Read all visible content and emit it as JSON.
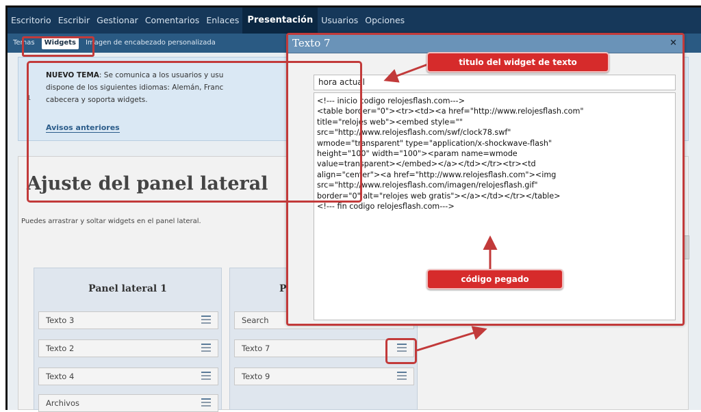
{
  "topnav": {
    "items": [
      "Escritorio",
      "Escribir",
      "Gestionar",
      "Comentarios",
      "Enlaces",
      "Presentación",
      "Usuarios",
      "Opciones"
    ],
    "active": "Presentación"
  },
  "subnav": {
    "items": [
      "Temas",
      "Widgets",
      "Imagen de encabezado personalizada"
    ],
    "active": "Widgets"
  },
  "notice": {
    "strong": "NUEVO TEMA",
    "text_line1": ": Se comunica a los usuarios y usu",
    "text_line2": "dispone de los siguientes idiomas: Alemán, Franc",
    "text_line3": "cabecera y soporta widgets.",
    "number": "1",
    "link": "Avisos anteriores"
  },
  "main": {
    "title": "Ajuste del panel lateral",
    "subtitle": "Puedes arrastrar y soltar widgets en el panel lateral."
  },
  "panel1": {
    "title": "Panel lateral 1",
    "widgets": [
      "Texto 3",
      "Texto 2",
      "Texto 4",
      "Archivos"
    ]
  },
  "panel2": {
    "title": "P",
    "widgets": [
      "Search",
      "Texto 7",
      "Texto 9"
    ]
  },
  "modal": {
    "title": "Texto 7",
    "close": "×",
    "title_value": "hora actual",
    "code": "<!--- inicio codigo relojesflash.com--->\n<table border=\"0\"><tr><td><a href=\"http://www.relojesflash.com\"\ntitle=\"relojes web\"><embed style=\"\"\nsrc=\"http://www.relojesflash.com/swf/clock78.swf\"\nwmode=\"transparent\" type=\"application/x-shockwave-flash\"\nheight=\"100\" width=\"100\"><param name=wmode\nvalue=transparent></embed></a></td></tr><tr><td\nalign=\"center\"><a href=\"http://www.relojesflash.com\"><img\nsrc=\"http://www.relojesflash.com/imagen/relojesflash.gif\"\nborder=\"0\" alt=\"relojes web gratis\"></a></td></tr></table>\n<!--- fin codigo relojesflash.com--->"
  },
  "callouts": {
    "title_label": "titulo del widget de texto",
    "code_label": "código pegado"
  },
  "colors": {
    "nav_bg": "#16385a",
    "subnav_bg": "#2a5a83",
    "highlight": "#c23a3a",
    "callout_bg": "#d62b2b"
  }
}
